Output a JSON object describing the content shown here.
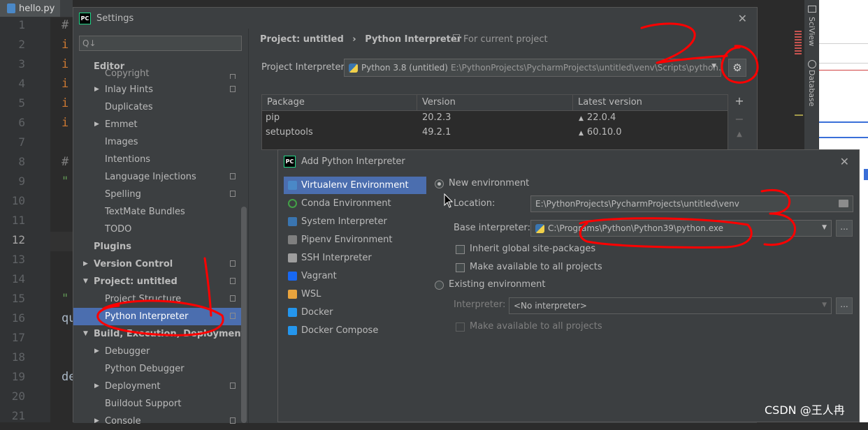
{
  "editor": {
    "tab_label": "hello.py",
    "line_numbers": [
      "1",
      "2",
      "3",
      "4",
      "5",
      "6",
      "7",
      "8",
      "9",
      "10",
      "11",
      "12",
      "13",
      "14",
      "15",
      "16",
      "17",
      "18",
      "19",
      "20",
      "21"
    ],
    "current_line": "12",
    "code_fragments": [
      {
        "line": "1",
        "text": "#"
      },
      {
        "line": "2",
        "text": "i"
      },
      {
        "line": "3",
        "text": "i"
      },
      {
        "line": "4",
        "text": "i"
      },
      {
        "line": "5",
        "text": "i"
      },
      {
        "line": "6",
        "text": "i"
      },
      {
        "line": "8",
        "text": "#"
      },
      {
        "line": "9",
        "text": "\""
      },
      {
        "line": "15",
        "text": "\""
      },
      {
        "line": "16",
        "text": "qu"
      },
      {
        "line": "19",
        "text": "de"
      }
    ],
    "right_tools": [
      "SciView",
      "Database"
    ]
  },
  "settings": {
    "title": "Settings",
    "search_placeholder": "Q↓",
    "tree": [
      {
        "label": "Editor",
        "bold": true
      },
      {
        "label": "Copyright"
      },
      {
        "label": "Inlay Hints",
        "arrow": true
      },
      {
        "label": "Duplicates"
      },
      {
        "label": "Emmet",
        "arrow": true
      },
      {
        "label": "Images"
      },
      {
        "label": "Intentions"
      },
      {
        "label": "Language Injections"
      },
      {
        "label": "Spelling"
      },
      {
        "label": "TextMate Bundles"
      },
      {
        "label": "TODO"
      },
      {
        "label": "Plugins",
        "bold": true
      },
      {
        "label": "Version Control",
        "bold": true,
        "arrow": true
      },
      {
        "label": "Project: untitled",
        "bold": true,
        "arrow": true,
        "expanded": true
      },
      {
        "label": "Project Structure"
      },
      {
        "label": "Python Interpreter",
        "selected": true
      },
      {
        "label": "Build, Execution, Deployment",
        "bold": true,
        "arrow": true,
        "expanded": true
      },
      {
        "label": "Debugger",
        "arrow": true
      },
      {
        "label": "Python Debugger"
      },
      {
        "label": "Deployment",
        "arrow": true
      },
      {
        "label": "Buildout Support"
      },
      {
        "label": "Console",
        "arrow": true
      }
    ],
    "breadcrumb": {
      "project": "Project: untitled",
      "separator": "›",
      "page": "Python Interpreter"
    },
    "for_current_project": "For current project",
    "interpreter_label": "Project Interpreter:",
    "interpreter_name": "Python 3.8 (untitled)",
    "interpreter_path": "E:\\PythonProjects\\PycharmProjects\\untitled\\venv\\Scripts\\python.exe",
    "packages": {
      "columns": [
        "Package",
        "Version",
        "Latest version"
      ],
      "rows": [
        {
          "package": "pip",
          "version": "20.2.3",
          "latest": "22.0.4"
        },
        {
          "package": "setuptools",
          "version": "49.2.1",
          "latest": "60.10.0"
        }
      ]
    }
  },
  "add_interpreter": {
    "title": "Add Python Interpreter",
    "environments": [
      {
        "label": "Virtualenv Environment",
        "selected": true,
        "color": "#4a88c7"
      },
      {
        "label": "Conda Environment",
        "color": "#43a047"
      },
      {
        "label": "System Interpreter",
        "color": "#3a75b0"
      },
      {
        "label": "Pipenv Environment",
        "color": "#7f7f7f"
      },
      {
        "label": "SSH Interpreter",
        "color": "#9e9e9e"
      },
      {
        "label": "Vagrant",
        "color": "#1868f2"
      },
      {
        "label": "WSL",
        "color": "#e8a33d"
      },
      {
        "label": "Docker",
        "color": "#2496ed"
      },
      {
        "label": "Docker Compose",
        "color": "#2496ed"
      }
    ],
    "new_env_label": "New environment",
    "location_label": "Location:",
    "location_value": "E:\\PythonProjects\\PycharmProjects\\untitled\\venv",
    "base_label": "Base interpreter:",
    "base_value": "C:\\Programs\\Python\\Python39\\python.exe",
    "inherit_label": "Inherit global site-packages",
    "make_available_label": "Make available to all projects",
    "existing_env_label": "Existing environment",
    "interpreter_label": "Interpreter:",
    "interpreter_value": "<No interpreter>",
    "existing_make_available_label": "Make available to all projects",
    "browse_label": "..."
  },
  "watermark": "CSDN @王人冉",
  "colors": {
    "selection": "#4b6eaf",
    "annotation": "#ff0000",
    "background": "#3c3f41"
  }
}
